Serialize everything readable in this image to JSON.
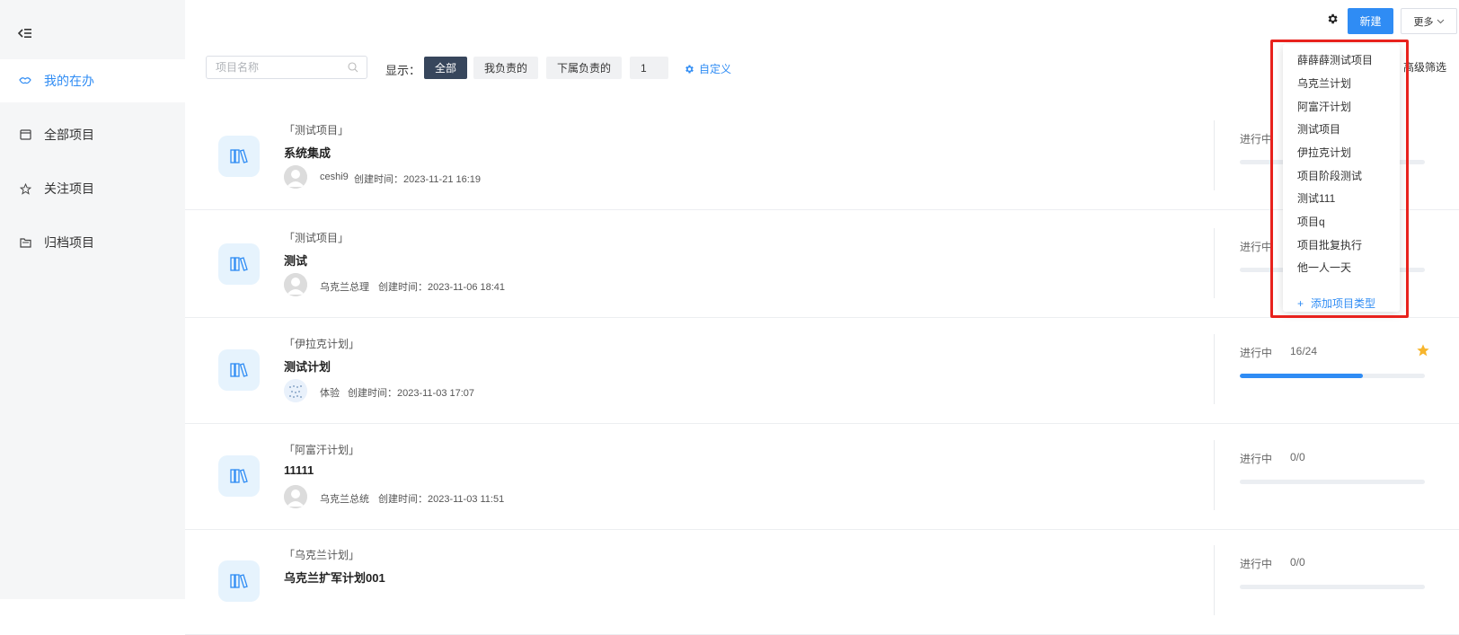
{
  "sidebar": {
    "items": [
      {
        "label": "我的在办",
        "icon": "handshake-icon",
        "active": true
      },
      {
        "label": "全部项目",
        "icon": "window-icon",
        "active": false
      },
      {
        "label": "关注项目",
        "icon": "star-outline-icon",
        "active": false
      },
      {
        "label": "归档项目",
        "icon": "archive-icon",
        "active": false
      }
    ]
  },
  "toolbar": {
    "search_placeholder": "项目名称",
    "show_label": "显示：",
    "filters": [
      {
        "label": "全部",
        "active": true
      },
      {
        "label": "我负责的",
        "active": false
      },
      {
        "label": "下属负责的",
        "active": false
      },
      {
        "label": "1",
        "active": false
      }
    ],
    "customize_label": "自定义",
    "advanced_filter_label": "高级筛选"
  },
  "header": {
    "new_label": "新建",
    "more_label": "更多"
  },
  "projects": [
    {
      "type": "「测试项目」",
      "name": "系统集成",
      "owner": "ceshi9",
      "created": "创建时间：2023-11-21 16:19",
      "status": "进行中",
      "progress": "",
      "progress_fraction": 0,
      "starred": false
    },
    {
      "type": "「测试项目」",
      "name": "测试",
      "owner": "乌克兰总理",
      "created": "创建时间：2023-11-06 18:41",
      "status": "进行中",
      "progress": "",
      "progress_fraction": 0,
      "starred": false
    },
    {
      "type": "「伊拉克计划」",
      "name": "测试计划",
      "owner": "体验",
      "created": "创建时间：2023-11-03 17:07",
      "status": "进行中",
      "progress": "16/24",
      "progress_fraction": 0.6667,
      "starred": true
    },
    {
      "type": "「阿富汗计划」",
      "name": "11111",
      "owner": "乌克兰总统",
      "created": "创建时间：2023-11-03 11:51",
      "status": "进行中",
      "progress": "0/0",
      "progress_fraction": 0,
      "starred": false
    },
    {
      "type": "「乌克兰计划」",
      "name": "乌克兰扩军计划001",
      "owner": "",
      "created": "",
      "status": "进行中",
      "progress": "0/0",
      "progress_fraction": 0,
      "starred": false
    }
  ],
  "dropdown": {
    "items": [
      "薛薛薛测试项目",
      "乌克兰计划",
      "阿富汗计划",
      "测试项目",
      "伊拉克计划",
      "项目阶段测试",
      "测试111",
      "项目q",
      "项目批复执行",
      "他一人一天"
    ],
    "add_label": "添加项目类型"
  },
  "colors": {
    "accent": "#2f8cf4",
    "highlight": "#e8221d",
    "star": "#f7b52c",
    "active_filter": "#37465c"
  }
}
